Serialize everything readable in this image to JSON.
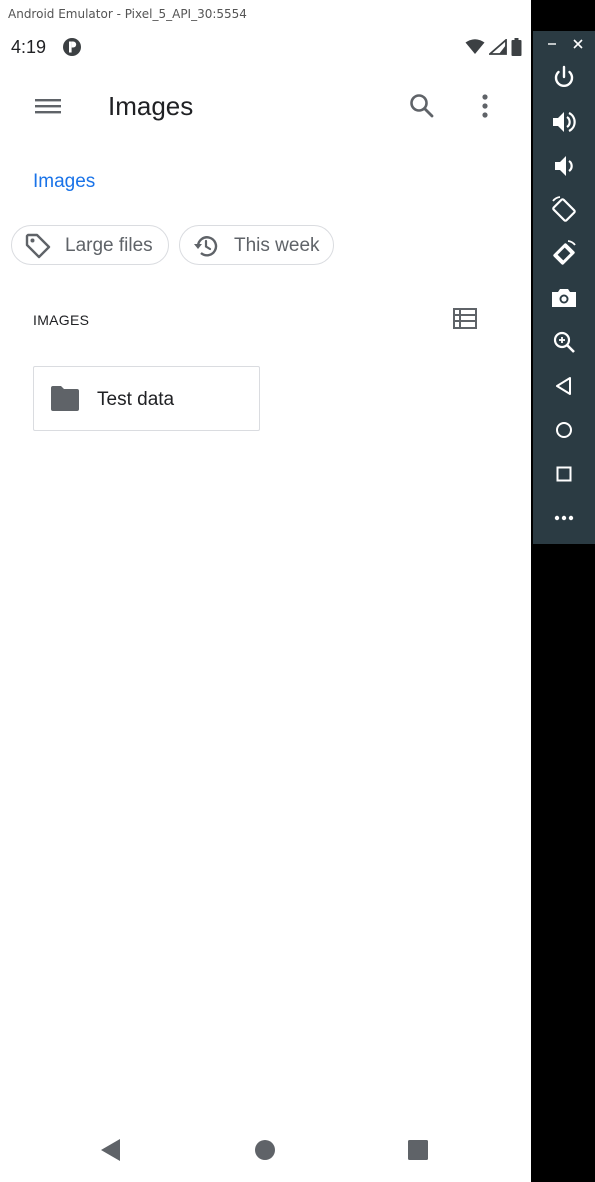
{
  "window": {
    "title": "Android Emulator - Pixel_5_API_30:5554"
  },
  "status_bar": {
    "time": "4:19"
  },
  "toolbar": {
    "title": "Images"
  },
  "breadcrumb": {
    "label": "Images"
  },
  "chips": [
    {
      "label": "Large files",
      "icon": "tag-icon"
    },
    {
      "label": "This week",
      "icon": "history-icon"
    }
  ],
  "section": {
    "header": "IMAGES"
  },
  "folders": [
    {
      "label": "Test data",
      "icon": "folder-icon"
    }
  ],
  "colors": {
    "accent": "#1a73e8",
    "panel": "#2b3b43",
    "text_secondary": "#5f6368"
  }
}
